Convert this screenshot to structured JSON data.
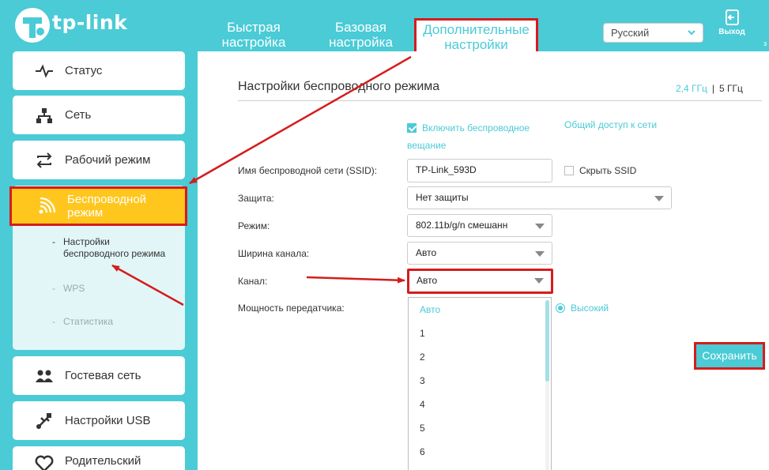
{
  "brand": {
    "logo_text": "tp-link"
  },
  "nav": {
    "quick": "Быстрая настройка",
    "basic": "Базовая настройка",
    "advanced": "Дополнительные настройки"
  },
  "header": {
    "language": "Русский",
    "logout": "Выход",
    "edge_fragment": "з"
  },
  "sidebar": {
    "status": "Статус",
    "network": "Сеть",
    "operation_mode": "Рабочий режим",
    "wireless": "Беспроводной режим",
    "sub": {
      "settings": "Настройки беспроводного режима",
      "wps": "WPS",
      "stats": "Статистика"
    },
    "guest": "Гостевая сеть",
    "usb": "Настройки USB",
    "parental": "Родительский"
  },
  "main": {
    "title": "Настройки беспроводного режима",
    "band_24": "2,4 ГГц",
    "band_sep": "|",
    "band_5": "5 ГГц",
    "enable_label": "Включить беспроводное вещание",
    "enable_checked": true,
    "share_label": "Общий доступ к сети",
    "labels": {
      "ssid": "Имя беспроводной сети (SSID):",
      "security": "Защита:",
      "mode": "Режим:",
      "channel_width": "Ширина канала:",
      "channel": "Канал:",
      "tx_power": "Мощность передатчика:"
    },
    "ssid_value": "TP-Link_593D",
    "hide_ssid": "Скрыть SSID",
    "hide_ssid_checked": false,
    "security_value": "Нет защиты",
    "mode_value": "802.11b/g/n смешанн",
    "width_value": "Авто",
    "channel_value": "Авто",
    "channel_options": [
      "Авто",
      "1",
      "2",
      "3",
      "4",
      "5",
      "6"
    ],
    "power_value": "Высокий",
    "save": "Сохранить"
  },
  "colors": {
    "brand": "#4acbd6",
    "highlight": "#ffc61e",
    "annotation": "#d51c1c"
  }
}
